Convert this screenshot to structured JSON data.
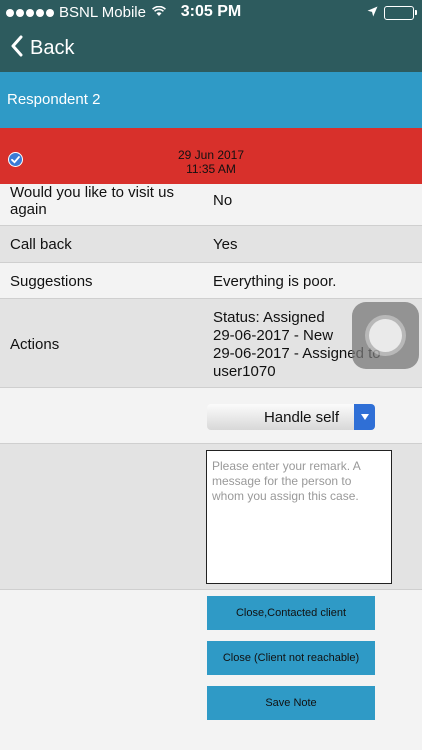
{
  "status_bar": {
    "carrier": "BSNL Mobile",
    "time": "3:05 PM",
    "icons": [
      "signal-dots-icon",
      "wifi-icon",
      "location-arrow-icon",
      "battery-icon"
    ]
  },
  "nav": {
    "back_label": "Back"
  },
  "title": "Respondent 2",
  "record": {
    "date": "29 Jun 2017",
    "time": "11:35 AM"
  },
  "rows": [
    {
      "label": "Would you like to visit us again",
      "value": "No"
    },
    {
      "label": "Call back",
      "value": "Yes"
    },
    {
      "label": "Suggestions",
      "value": "Everything is poor."
    },
    {
      "label": "Actions",
      "value_lines": [
        "Status: Assigned",
        "29-06-2017 - New",
        "29-06-2017 - Assigned to",
        "user1070"
      ]
    }
  ],
  "assign": {
    "selected": "Handle self"
  },
  "remark": {
    "placeholder": "Please enter your remark. A message for the person to whom you assign this case.",
    "value": ""
  },
  "buttons": {
    "close_contacted": "Close,Contacted client",
    "close_unreachable": "Close (Client not reachable)",
    "save_note": "Save Note"
  },
  "colors": {
    "nav_bg": "#2d5b5e",
    "title_bg": "#2f9ac6",
    "alert_bg": "#d8302b",
    "button_bg": "#2f9ac6",
    "dropdown_arrow": "#2f6fd6"
  }
}
